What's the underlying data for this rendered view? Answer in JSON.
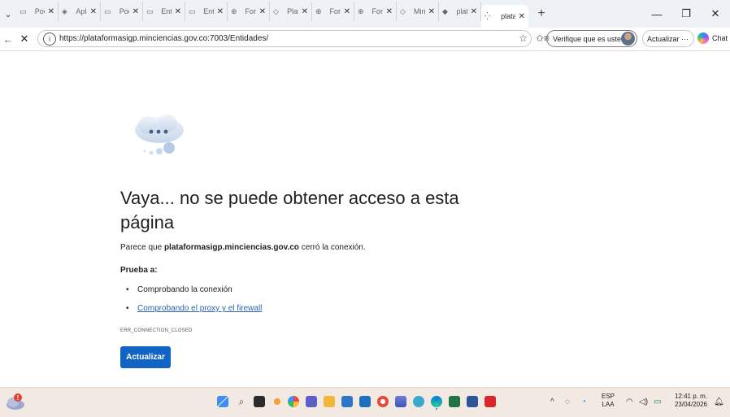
{
  "browser": {
    "tab_menu_icon": "chevron-down-icon",
    "tabs": [
      {
        "title": "Pool",
        "icon": "page-icon",
        "active": false
      },
      {
        "title": "Aplic",
        "icon": "app-icon",
        "active": false
      },
      {
        "title": "Pool",
        "icon": "page-icon",
        "active": false
      },
      {
        "title": "Entid",
        "icon": "page-icon",
        "active": false
      },
      {
        "title": "Entid",
        "icon": "page-icon",
        "active": false
      },
      {
        "title": "Form",
        "icon": "globe-icon",
        "active": false
      },
      {
        "title": "Plata",
        "icon": "shield-icon",
        "active": false
      },
      {
        "title": "Form",
        "icon": "globe-icon",
        "active": false
      },
      {
        "title": "Form",
        "icon": "globe-icon",
        "active": false
      },
      {
        "title": "Minci",
        "icon": "shield-icon",
        "active": false
      },
      {
        "title": "plata",
        "icon": "paint-icon",
        "active": false
      },
      {
        "title": "plata",
        "icon": "loading-icon",
        "active": true
      }
    ],
    "tab_close_glyph": "✕",
    "new_tab_glyph": "+",
    "window_controls": {
      "minimize": "—",
      "restore": "❐",
      "close": "✕"
    },
    "url": "https://plataformasigp.minciencias.gov.co:7003/Entidades/",
    "verify_label": "Verifique que es usted",
    "update_label": "Actualizar ···",
    "copilot_label": "Chat"
  },
  "error_page": {
    "title": "Vaya... no se puede obtener acceso a esta página",
    "desc_prefix": "Parece que ",
    "desc_host": "plataformasigp.minciencias.gov.co",
    "desc_suffix": " cerró la conexión.",
    "try_label": "Prueba a:",
    "suggestions": [
      "Comprobando la conexión",
      "Comprobando el proxy y el firewall"
    ],
    "bullet": "•",
    "error_code": "ERR_CONNECTION_CLOSED",
    "reload_label": "Actualizar"
  },
  "taskbar": {
    "language_line1": "ESP",
    "language_line2": "LAA",
    "time": "12:41 p. m.",
    "date": "23/04/2026",
    "weather_alert": "!",
    "tray_chevron": "^"
  },
  "colors": {
    "accent": "#1163c4",
    "link": "#2a5fb0",
    "tabstrip": "#eef1f6",
    "taskbar": "#f3e9e3"
  }
}
